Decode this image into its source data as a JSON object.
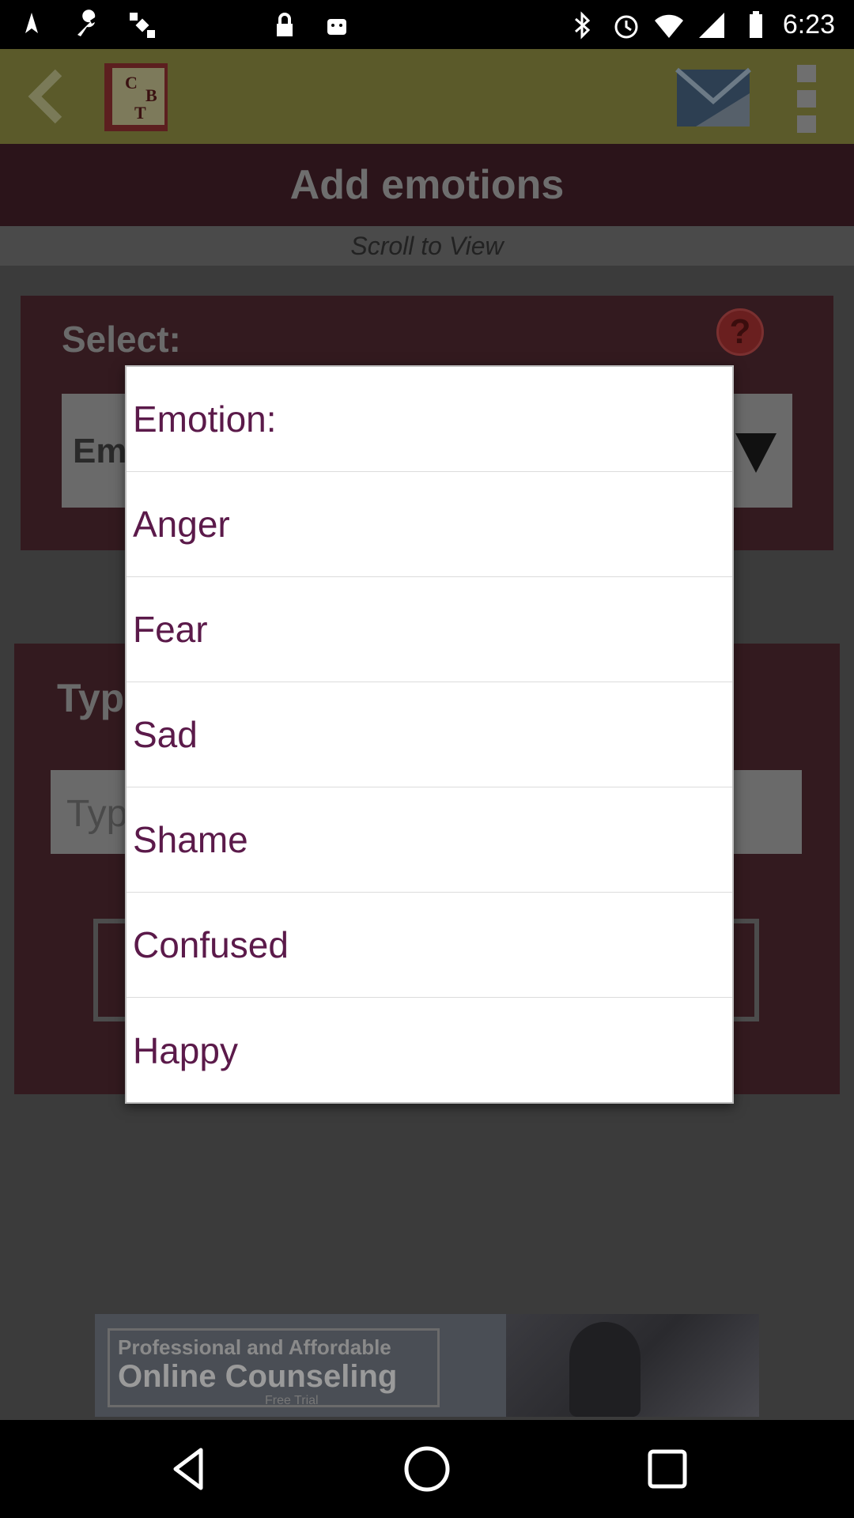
{
  "status_bar": {
    "time": "6:23",
    "icons_left": [
      "fake-gps-icon",
      "wrench-icon",
      "satellite-icon",
      "lock-icon",
      "android-icon"
    ],
    "icons_right": [
      "bluetooth-icon",
      "alarm-icon",
      "wifi-icon",
      "signal-icon",
      "battery-icon"
    ]
  },
  "action_bar": {
    "logo_letters": [
      "C",
      "B",
      "T"
    ]
  },
  "header": {
    "title": "Add emotions",
    "subtitle": "Scroll to View"
  },
  "select_section": {
    "label": "Select:",
    "dropdown_value": "Em"
  },
  "type_section": {
    "label": "Typ",
    "input_placeholder": "Typ"
  },
  "ad": {
    "line1": "Professional and Affordable",
    "line2": "Online Counseling",
    "line3": "Free Trial"
  },
  "dialog": {
    "items": [
      {
        "label": "Emotion:"
      },
      {
        "label": "Anger"
      },
      {
        "label": "Fear"
      },
      {
        "label": "Sad"
      },
      {
        "label": "Shame"
      },
      {
        "label": "Confused"
      },
      {
        "label": "Happy"
      }
    ]
  },
  "colors": {
    "dialog_text": "#5b1a4a",
    "scrim": "#3a3a3a"
  }
}
